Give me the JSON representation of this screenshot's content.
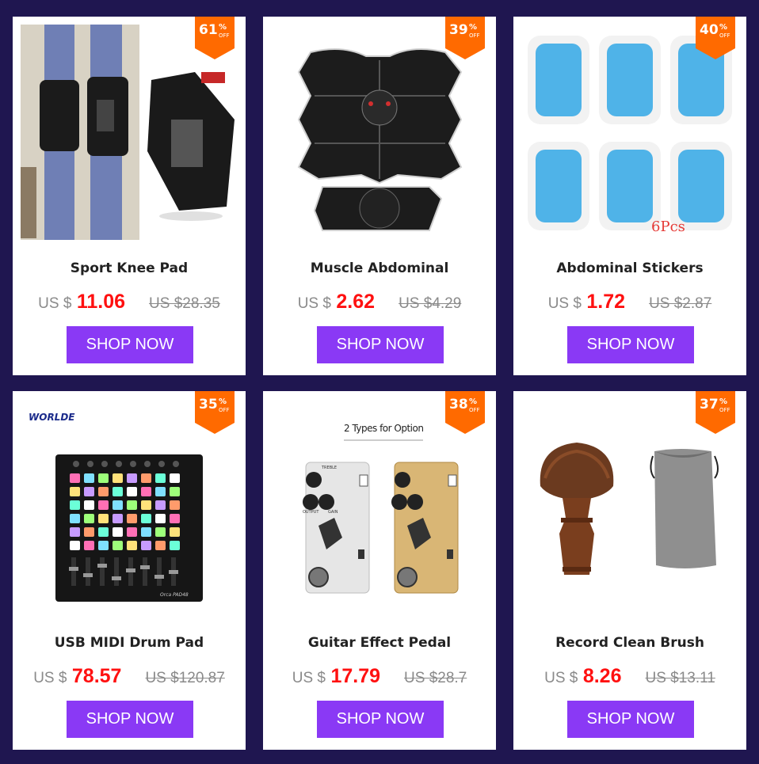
{
  "products": [
    {
      "name": "Sport Knee Pad",
      "discount": "61",
      "currency": "US $",
      "price": "11.06",
      "old_price": "US $28.35",
      "button": "SHOP NOW"
    },
    {
      "name": "Muscle Abdominal",
      "discount": "39",
      "currency": "US $",
      "price": "2.62",
      "old_price": "US $4.29",
      "button": "SHOP NOW"
    },
    {
      "name": "Abdominal Stickers",
      "discount": "40",
      "currency": "US $",
      "price": "1.72",
      "old_price": "US $2.87",
      "button": "SHOP NOW",
      "image_caption": "6Pcs"
    },
    {
      "name": "USB MIDI Drum Pad",
      "discount": "35",
      "currency": "US $",
      "price": "78.57",
      "old_price": "US $120.87",
      "button": "SHOP NOW",
      "image_logo": "WORLDE",
      "image_model": "Orca PAD48"
    },
    {
      "name": "Guitar Effect Pedal",
      "discount": "38",
      "currency": "US $",
      "price": "17.79",
      "old_price": "US $28.7",
      "button": "SHOP NOW",
      "image_caption": "2 Types for Option",
      "pedal_labels": [
        "TREBLE",
        "OUTPUT",
        "GAIN"
      ]
    },
    {
      "name": "Record Clean Brush",
      "discount": "37",
      "currency": "US $",
      "price": "8.26",
      "old_price": "US $13.11",
      "button": "SHOP NOW"
    }
  ],
  "badge_text": {
    "percent": "%",
    "off": "OFF"
  },
  "colors": {
    "background": "#1f1650",
    "badge": "#ff6a00",
    "button": "#8a39f5",
    "price": "#ff1010"
  }
}
